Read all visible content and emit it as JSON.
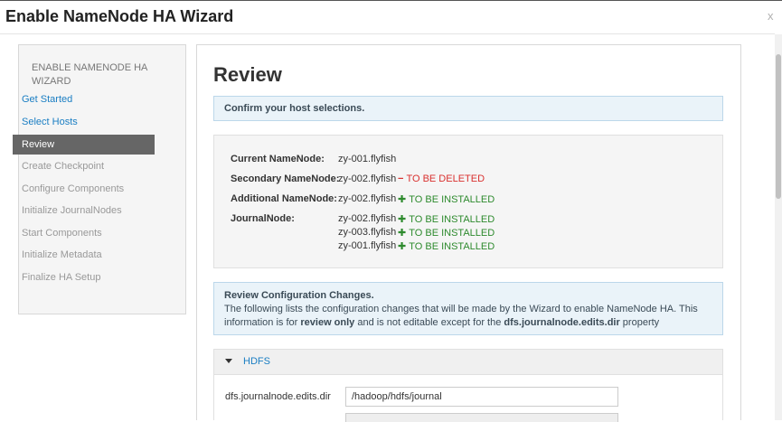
{
  "modal": {
    "title": "Enable NameNode HA Wizard",
    "close_label": "x"
  },
  "sidebar": {
    "header": "ENABLE NAMENODE HA WIZARD",
    "items": [
      {
        "label": "Get Started",
        "state": "link"
      },
      {
        "label": "Select Hosts",
        "state": "link"
      },
      {
        "label": "Review",
        "state": "active"
      },
      {
        "label": "Create Checkpoint",
        "state": "disabled"
      },
      {
        "label": "Configure Components",
        "state": "disabled"
      },
      {
        "label": "Initialize JournalNodes",
        "state": "disabled"
      },
      {
        "label": "Start Components",
        "state": "disabled"
      },
      {
        "label": "Initialize Metadata",
        "state": "disabled"
      },
      {
        "label": "Finalize HA Setup",
        "state": "disabled"
      }
    ]
  },
  "main": {
    "title": "Review",
    "confirm_alert": "Confirm your host selections.",
    "hosts": {
      "current_namenode": {
        "label": "Current NameNode:",
        "host": "zy-001.flyfish"
      },
      "secondary_namenode": {
        "label": "Secondary NameNode:",
        "host": "zy-002.flyfish",
        "status_symbol": "−",
        "status": "TO BE DELETED"
      },
      "additional_namenode": {
        "label": "Additional NameNode:",
        "host": "zy-002.flyfish",
        "status_symbol": "✚",
        "status": "TO BE INSTALLED"
      },
      "journalnode": {
        "label": "JournalNode:",
        "entries": [
          {
            "host": "zy-002.flyfish",
            "status_symbol": "✚",
            "status": "TO BE INSTALLED"
          },
          {
            "host": "zy-003.flyfish",
            "status_symbol": "✚",
            "status": "TO BE INSTALLED"
          },
          {
            "host": "zy-001.flyfish",
            "status_symbol": "✚",
            "status": "TO BE INSTALLED"
          }
        ]
      }
    },
    "config_alert": {
      "title": "Review Configuration Changes.",
      "text_1": "The following lists the configuration changes that will be made by the Wizard to enable NameNode HA. This information is for ",
      "text_bold_1": "review only",
      "text_2": " and is not editable except for the ",
      "text_bold_2": "dfs.journalnode.edits.dir",
      "text_3": " property"
    },
    "hdfs_section": {
      "label": "HDFS",
      "property_label": "dfs.journalnode.edits.dir",
      "property_value": "/hadoop/hdfs/journal"
    }
  },
  "colors": {
    "accent": "#1a7ec3",
    "active_nav": "#666666",
    "delete": "#d9312f",
    "install": "#2d8a2d",
    "info_bg": "#eaf3f9"
  }
}
